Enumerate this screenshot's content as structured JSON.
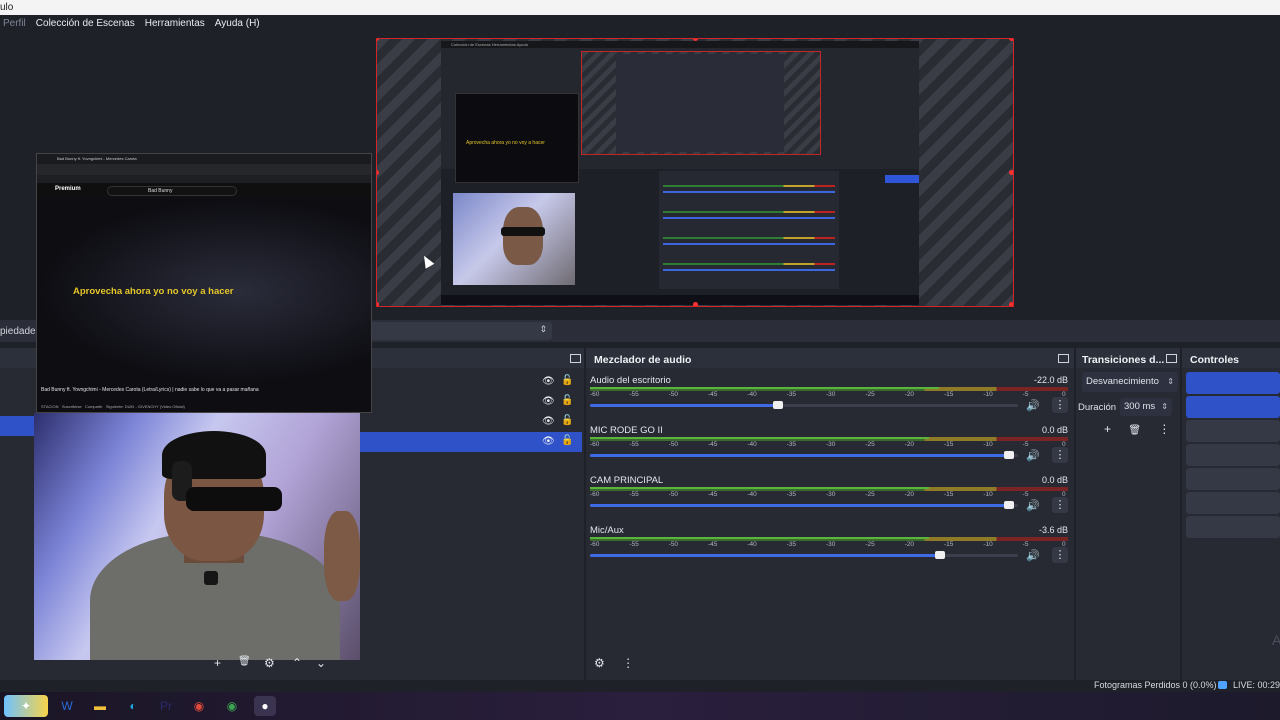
{
  "window": {
    "title_fragment": "ulo"
  },
  "menu": {
    "items": [
      "Perfil",
      "Colección de Escenas",
      "Herramientas",
      "Ayuda (H)"
    ]
  },
  "preview": {
    "inner_subtitle": "Aprovecha ahora yo no voy a hacer",
    "inner_menu": "Colección de Escenas   Herramientas   Ayuda"
  },
  "browser": {
    "tab_title": "Bad Bunny ft. Yovngchimi - Mercedes Carota",
    "youtube_logo": "Premium",
    "search_text": "Bad Bunny",
    "subtitle": "Aprovecha ahora yo no voy a hacer",
    "video_title": "Bad Bunny ft. Yovngchimi - Mercedes Carota (Letra/Lyrics) | nadie sabe lo que va a pasar mañana",
    "channel": "STACION",
    "subscribe": "Suscribirse",
    "share": "Compartir",
    "next_label": "Siguiente: DUKI - GIVENCHY (Video Oficial)"
  },
  "properties_strip": {
    "label": "piedades"
  },
  "sources": {
    "rows": [
      {
        "visible": true,
        "locked": false,
        "selected": false
      },
      {
        "visible": true,
        "locked": false,
        "selected": false
      },
      {
        "visible": true,
        "locked": false,
        "selected": false
      },
      {
        "visible": true,
        "locked": false,
        "selected": true
      }
    ],
    "toolbar": {
      "add": "+",
      "remove": "🗑",
      "settings": "⚙",
      "up": "⌃",
      "down": "⌄"
    }
  },
  "mixer": {
    "title": "Mezclador de audio",
    "scale": [
      "-60",
      "-55",
      "-50",
      "-45",
      "-40",
      "-35",
      "-30",
      "-25",
      "-20",
      "-15",
      "-10",
      "-5",
      "0"
    ],
    "channels": [
      {
        "name": "Audio del escritorio",
        "db": "-22.0 dB",
        "level": 0.45,
        "meter": 0.73
      },
      {
        "name": "MIC RODE GO II",
        "db": "0.0 dB",
        "level": 0.99,
        "meter": 0.71
      },
      {
        "name": "CAM PRINCIPAL",
        "db": "0.0 dB",
        "level": 0.99,
        "meter": 0.71
      },
      {
        "name": "Mic/Aux",
        "db": "-3.6 dB",
        "level": 0.83,
        "meter": 0.71
      }
    ]
  },
  "transitions": {
    "title": "Transiciones d...",
    "selected": "Desvanecimiento",
    "duration_label": "Duración",
    "duration_value": "300 ms"
  },
  "controls": {
    "title": "Controles",
    "buttons": [
      {
        "active": true
      },
      {
        "active": true
      },
      {
        "active": false
      },
      {
        "active": false
      },
      {
        "active": false
      },
      {
        "active": false
      },
      {
        "active": false
      }
    ]
  },
  "status": {
    "frames": "Fotogramas Perdidos 0 (0.0%)",
    "live": "LIVE: 00:29:"
  },
  "taskbar": {
    "apps": [
      {
        "name": "word-icon",
        "glyph": "W",
        "color": "#2b6bd6"
      },
      {
        "name": "explorer-icon",
        "glyph": "▬",
        "color": "#f0c03c"
      },
      {
        "name": "edge-icon",
        "glyph": "◐",
        "color": "#1ea2d8"
      },
      {
        "name": "premiere-icon",
        "glyph": "Pr",
        "color": "#2a2a6e"
      },
      {
        "name": "chrome-icon",
        "glyph": "◉",
        "color": "#e24a3b"
      },
      {
        "name": "chrome-alt-icon",
        "glyph": "◉",
        "color": "#3ca552"
      },
      {
        "name": "obs-icon",
        "glyph": "●",
        "color": "#222"
      }
    ]
  },
  "colors": {
    "accent": "#2f52c9",
    "selection_border": "#d4252b"
  }
}
